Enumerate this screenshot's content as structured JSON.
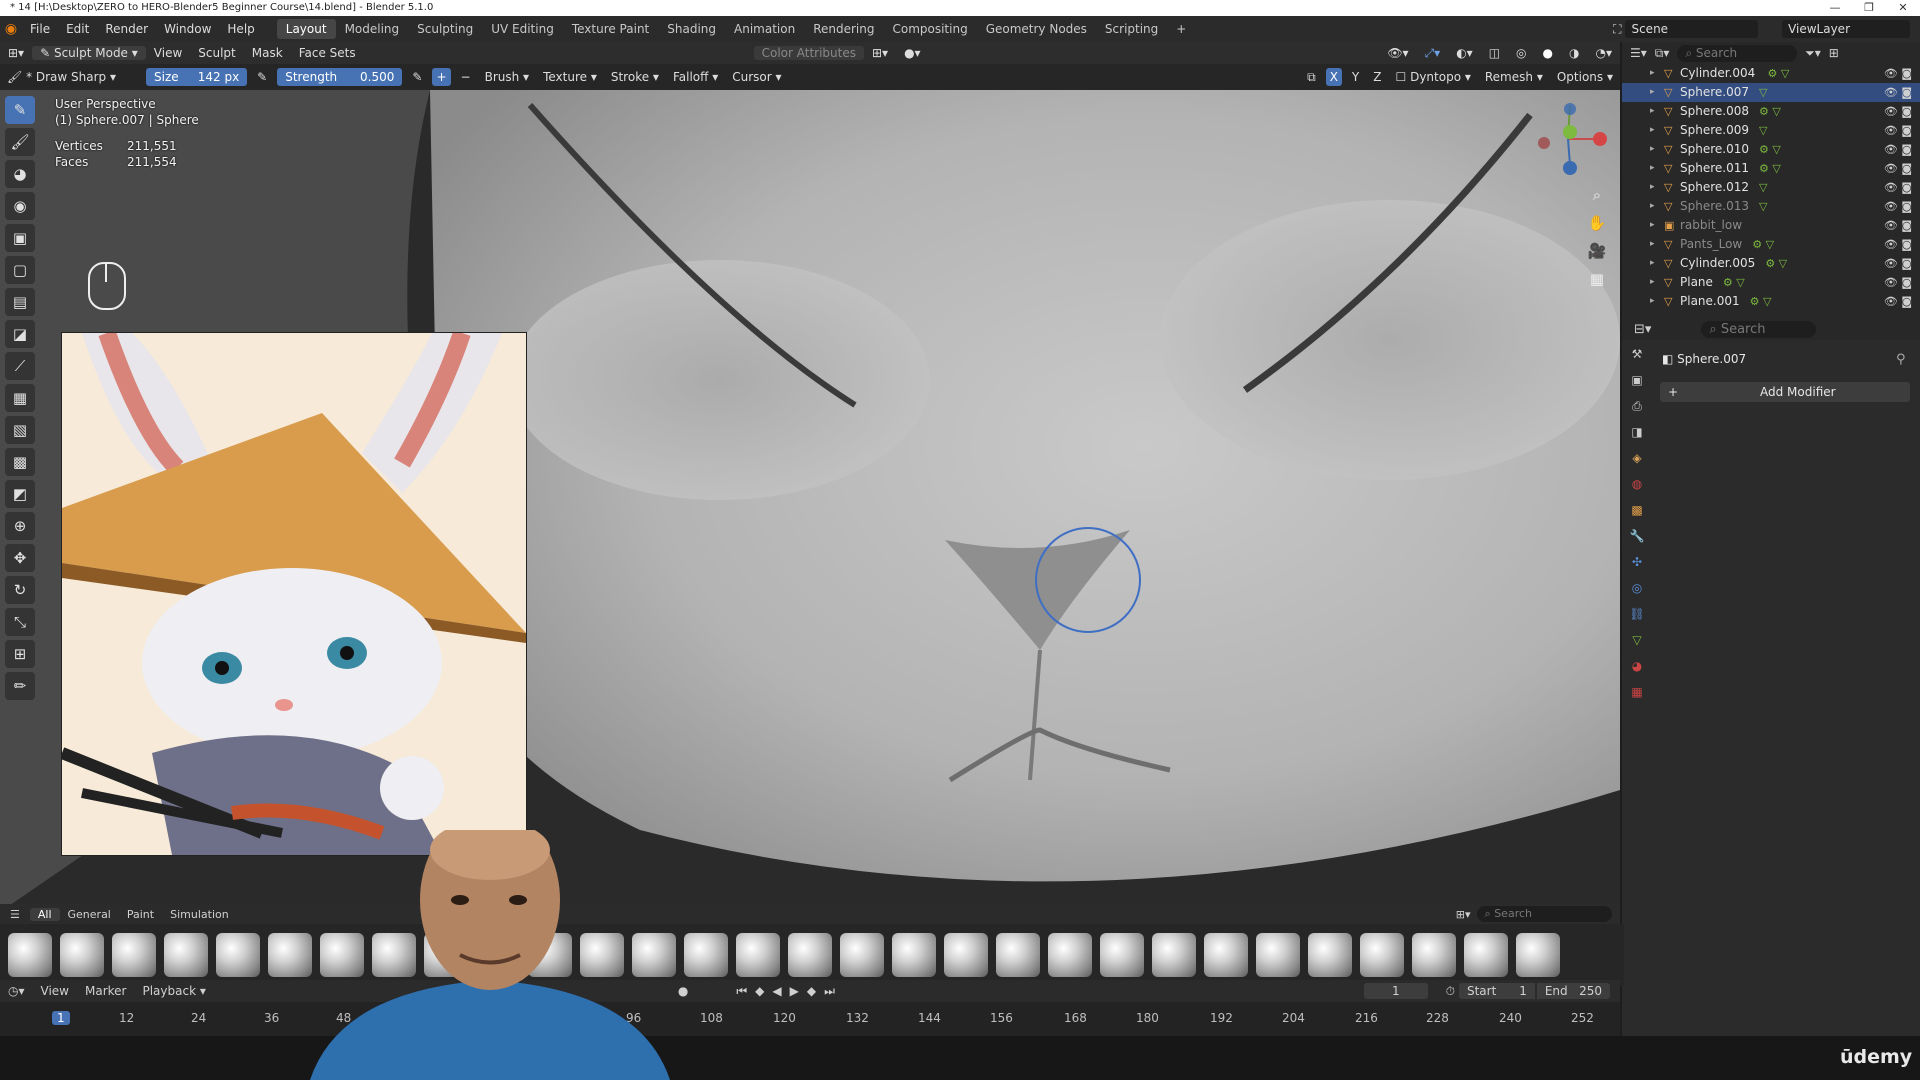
{
  "window": {
    "title": "* 14 [H:\\Desktop\\ZERO to HERO-Blender5 Beginner Course\\14.blend] - Blender 5.1.0",
    "controls": [
      "—",
      "❐",
      "✕"
    ]
  },
  "menu": [
    "File",
    "Edit",
    "Render",
    "Window",
    "Help"
  ],
  "workspaces": [
    "Layout",
    "Modeling",
    "Sculpting",
    "UV Editing",
    "Texture Paint",
    "Shading",
    "Animation",
    "Rendering",
    "Compositing",
    "Geometry Nodes",
    "Scripting",
    "+"
  ],
  "active_workspace": "Layout",
  "scene": {
    "label": "Scene",
    "view_layer": "ViewLayer"
  },
  "header": {
    "mode": "Sculpt Mode",
    "menus": [
      "View",
      "Sculpt",
      "Mask",
      "Face Sets"
    ],
    "color_attributes": "Color Attributes"
  },
  "toolsettings": {
    "brush_name": "* Draw Sharp",
    "size_label": "Size",
    "size_value": "142 px",
    "strength_label": "Strength",
    "strength_value": "0.500",
    "menus": [
      "Brush",
      "Texture",
      "Stroke",
      "Falloff",
      "Cursor"
    ],
    "axes": [
      "X",
      "Y",
      "Z"
    ],
    "right_menus": [
      "Dyntopo",
      "Remesh",
      "Options"
    ]
  },
  "viewport": {
    "perspective": "User Perspective",
    "object": "(1) Sphere.007 | Sphere",
    "stats": [
      {
        "label": "Vertices",
        "value": "211,551"
      },
      {
        "label": "Faces",
        "value": "211,554"
      }
    ]
  },
  "outliner": {
    "search_placeholder": "Search",
    "rows": [
      {
        "name": "Cylinder.004",
        "selected": false,
        "dim": false,
        "icon": "▽",
        "children": " ⚙ ▽"
      },
      {
        "name": "Sphere.007",
        "selected": true,
        "dim": false,
        "icon": "▽",
        "children": "▽"
      },
      {
        "name": "Sphere.008",
        "selected": false,
        "dim": false,
        "icon": "▽",
        "children": "⚙ ▽"
      },
      {
        "name": "Sphere.009",
        "selected": false,
        "dim": false,
        "icon": "▽",
        "children": "▽"
      },
      {
        "name": "Sphere.010",
        "selected": false,
        "dim": false,
        "icon": "▽",
        "children": "⚙ ▽"
      },
      {
        "name": "Sphere.011",
        "selected": false,
        "dim": false,
        "icon": "▽",
        "children": "⚙ ▽"
      },
      {
        "name": "Sphere.012",
        "selected": false,
        "dim": false,
        "icon": "▽",
        "children": "▽"
      },
      {
        "name": "Sphere.013",
        "selected": false,
        "dim": true,
        "icon": "▽",
        "children": "▽"
      },
      {
        "name": "rabbit_low",
        "selected": false,
        "dim": true,
        "icon": "▣",
        "children": ""
      },
      {
        "name": "Pants_Low",
        "selected": false,
        "dim": true,
        "icon": "▽",
        "children": "⚙ ▽"
      },
      {
        "name": "Cylinder.005",
        "selected": false,
        "dim": false,
        "icon": "▽",
        "children": "⚙ ▽"
      },
      {
        "name": "Plane",
        "selected": false,
        "dim": false,
        "icon": "▽",
        "children": "⚙ ▽"
      },
      {
        "name": "Plane.001",
        "selected": false,
        "dim": false,
        "icon": "▽",
        "children": "⚙ ▽"
      }
    ]
  },
  "properties": {
    "search_placeholder": "Search",
    "object": "Sphere.007",
    "add_modifier": "Add Modifier"
  },
  "brush_assets": {
    "tabs": [
      "All",
      "General",
      "Paint",
      "Simulation"
    ],
    "active_tab": "All",
    "search_placeholder": "Search"
  },
  "timeline": {
    "menus": [
      "View",
      "Marker",
      "Playback"
    ],
    "current_frame": "1",
    "start_label": "Start",
    "start": "1",
    "end_label": "End",
    "end": "250",
    "ticks": [
      "1",
      "12",
      "24",
      "36",
      "48",
      "96",
      "108",
      "120",
      "132",
      "144",
      "156",
      "168",
      "180",
      "192",
      "204",
      "216",
      "228",
      "240",
      "252"
    ]
  },
  "watermark": "ūdemy"
}
